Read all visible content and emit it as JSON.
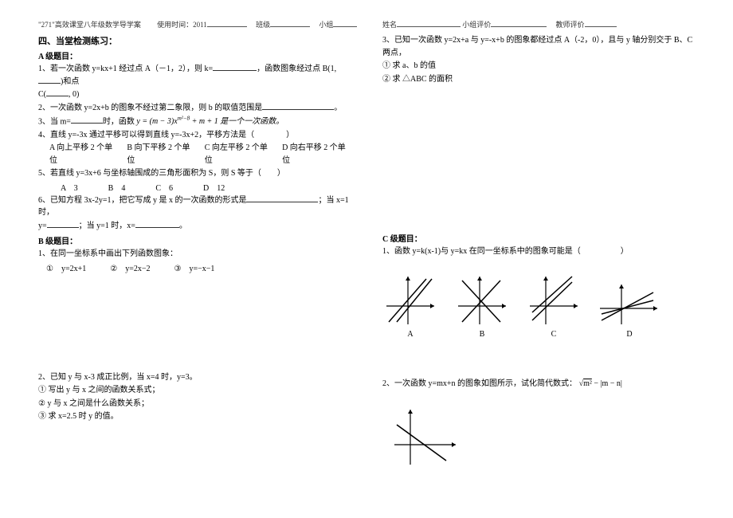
{
  "header": {
    "left_prefix": "\"271\"高效课堂八年级数学导学案",
    "use_time_label": "使用时间：2011",
    "class_label": "班级",
    "group_label": "小组",
    "name_label": "姓名",
    "group_eval_label": "小组评价",
    "teacher_eval_label": "教师评价"
  },
  "sec4": {
    "title": "四、当堂检测练习：",
    "levelA": {
      "title": "A 级题目：",
      "q1_a": "1、若一次函数 y=kx+1 经过点 A（－1，2），则 k=",
      "q1_b": "，函数图象经过点 B(1,",
      "q1_c": ")和点",
      "q1_d": "C(",
      "q1_e": ", 0)",
      "q2_a": "2、一次函数 y=2x+b 的图象不经过第二象限，则 b 的取值范围是",
      "q2_b": "。",
      "q3_a": "3、当 m=",
      "q3_b": "时，函数",
      "q3_formula": "y = (m − 3)x",
      "q3_exp": "m²−8",
      "q3_c": " + m + 1 是一个一次函数。",
      "q4": "4、直线 y=-3x 通过平移可以得到直线 y=-3x+2，平移方法是（　　　　）",
      "q4_optA": "A 向上平移 2 个单位",
      "q4_optB": "B 向下平移 2 个单位",
      "q4_optC": "C 向左平移 2 个单位",
      "q4_optD": "D 向右平移 2 个单位",
      "q5": "5、若直线 y=3x+6 与坐标轴围成的三角形面积为 S，则 S 等于（　　）",
      "q5_optA": "A　3",
      "q5_optB": "B　4",
      "q5_optC": "C　6",
      "q5_optD": "D　12",
      "q6_a": "6、已知方程 3x-2y=1，把它写成 y 是 x 的一次函数的形式是",
      "q6_b": "；当 x=1 时，",
      "q6_c": "y=",
      "q6_d": "；当 y=1 时，x=",
      "q6_e": "。"
    },
    "levelB": {
      "title": "B 级题目：",
      "q1": "1、在同一坐标系中画出下列函数图象：",
      "opt1": "①　y=2x+1",
      "opt2": "②　y=2x−2",
      "opt3": "③　y=−x−1",
      "q2": "2、已知 y 与 x-3 成正比例，当 x=4 时，y=3。",
      "q2_1": "① 写出 y 与 x 之间的函数关系式；",
      "q2_2": "② y 与 x 之间是什么函数关系；",
      "q2_3": "③ 求 x=2.5 时 y 的值。"
    }
  },
  "right": {
    "q3_a": "3、已知一次函数 y=2x+a 与 y=-x+b 的图象都经过点 A（-2，0），且与 y 轴分别交于 B、C 两点，",
    "q3_1": "① 求 a、b 的值",
    "q3_2": "② 求 △ABC 的面积",
    "levelC": {
      "title": "C 级题目：",
      "q1": "1、函数 y=k(x-1)与 y=kx 在同一坐标系中的图象可能是（　　　　　）",
      "labA": "A",
      "labB": "B",
      "labC": "C",
      "labD": "D",
      "q2_a": "2、一次函数 y=mx+n 的图象如图所示，试化简代数式：",
      "q2_formula": "√m² − |m − n|"
    }
  }
}
